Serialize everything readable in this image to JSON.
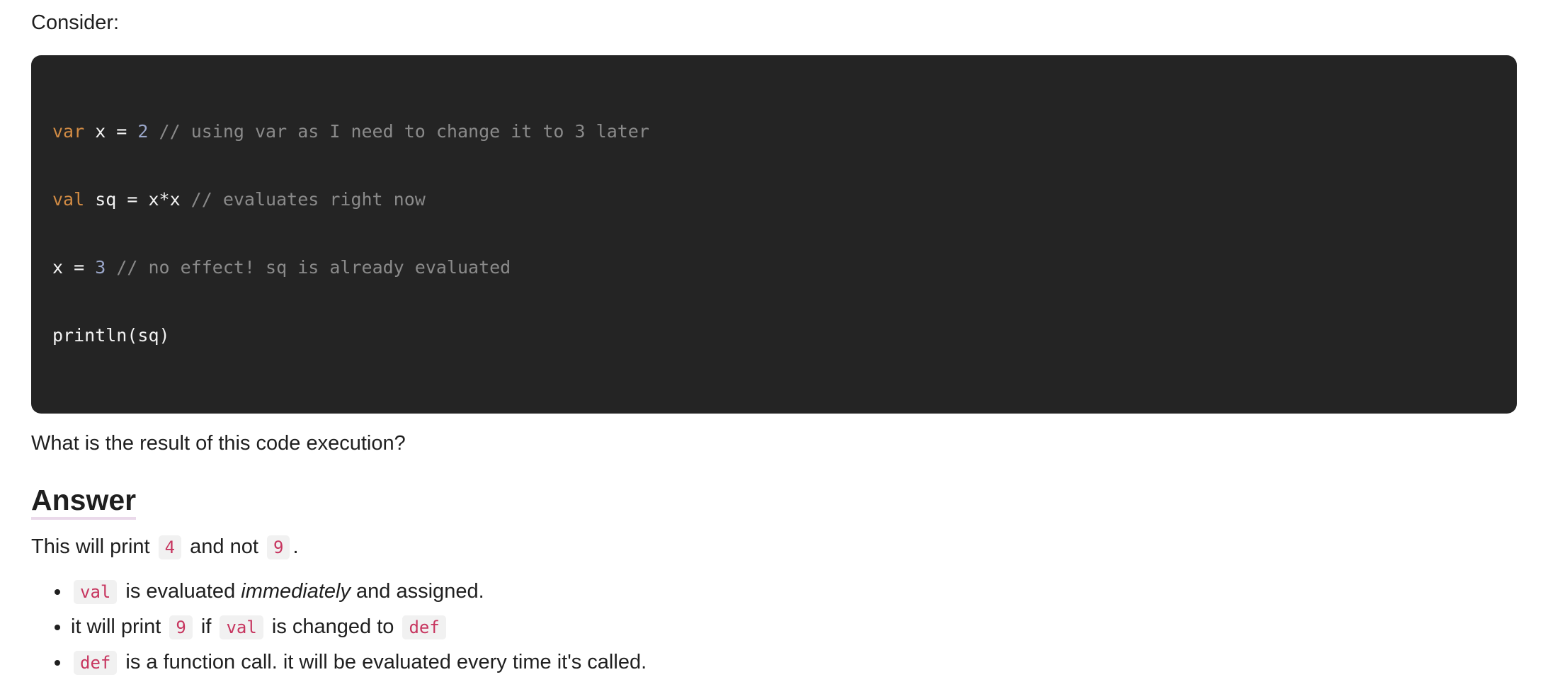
{
  "intro_text": "Consider:",
  "code": {
    "line1": {
      "kw": "var",
      "text1": " x = ",
      "num": "2",
      "comment": " // using var as I need to change it to 3 later"
    },
    "line2": {
      "kw": "val",
      "text1": " sq = x*x",
      "comment": " // evaluates right now"
    },
    "line3": {
      "text1": "x = ",
      "num": "3",
      "comment": " // no effect! sq is already evaluated"
    },
    "line4": {
      "text1": "println(sq)"
    }
  },
  "question_text": "What is the result of this code execution?",
  "answer_heading": "Answer",
  "answer_line": {
    "prefix": "This will print",
    "code1": "4",
    "middle": "and not",
    "code2": "9",
    "suffix": "."
  },
  "bullets": [
    {
      "code1": "val",
      "text1": "is evaluated",
      "em": "immediately",
      "text2": "and assigned."
    },
    {
      "text1": "it will print",
      "code1": "9",
      "text2": "if",
      "code2": "val",
      "text3": "is changed to",
      "code3": "def"
    },
    {
      "code1": "def",
      "text1": "is a function call. it will be evaluated every time it's called."
    }
  ]
}
